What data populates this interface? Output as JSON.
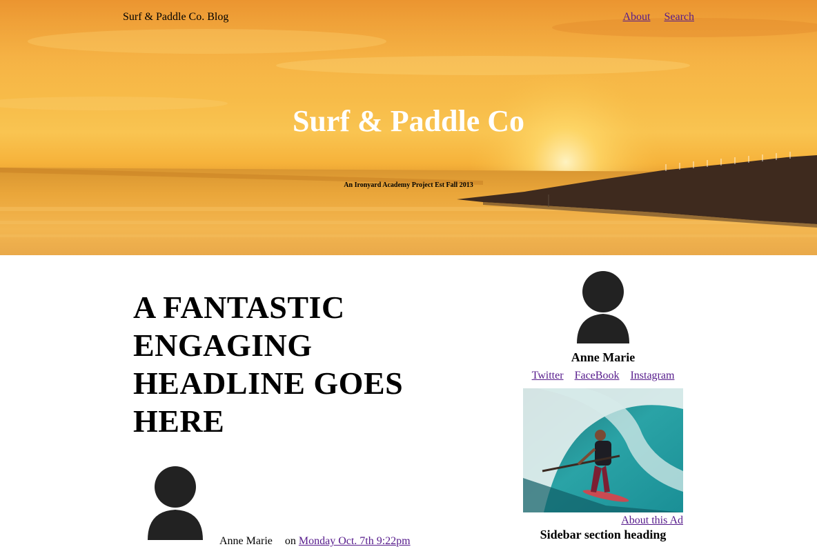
{
  "header": {
    "site_name": "Surf & Paddle Co. Blog",
    "nav": [
      "About",
      "Search"
    ]
  },
  "hero": {
    "title": "Surf & Paddle Co",
    "subtitle": "An Ironyard Academy Project Est Fall 2013"
  },
  "post": {
    "headline": "A FANTASTIC ENGAGING HEADLINE GOES HERE",
    "author": "Anne Marie",
    "on_label": "on",
    "date": "Monday Oct. 7th 9:22pm",
    "author_icon": "user-avatar-icon"
  },
  "sidebar": {
    "author_icon": "user-avatar-icon",
    "author_name": "Anne Marie",
    "social_links": [
      "Twitter",
      "FaceBook",
      "Instagram"
    ],
    "ad_image": "paddleboard-surfer-photo",
    "ad_link": "About this Ad",
    "section_heading": "Sidebar section heading"
  },
  "colors": {
    "link": "#551a8b",
    "hero_sky": "#f7bb48",
    "avatar": "#222222"
  }
}
